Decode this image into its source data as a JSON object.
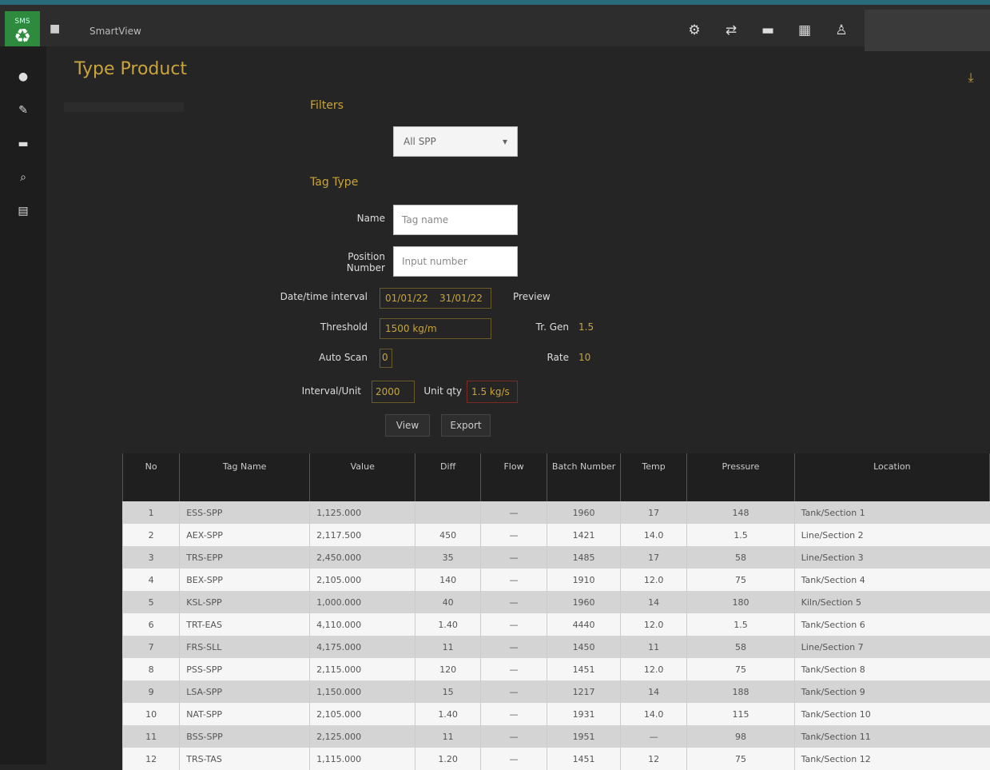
{
  "header": {
    "logo_mini": "SMS",
    "app_title": "SmartView"
  },
  "page": {
    "title": "Type Product"
  },
  "form": {
    "section1": "Filters",
    "select_value": "All SPP",
    "section2": "Tag Type",
    "field1_label": "Name",
    "field1_placeholder": "Tag name",
    "field2_label": "Position Number",
    "field2_placeholder": "Input number",
    "date_label": "Date/time interval",
    "date_from": "01/01/22",
    "date_to": "31/01/22",
    "preview_label": "Preview",
    "threshold_label": "Threshold",
    "threshold_value": "1500 kg/m",
    "tr_label": "Tr. Gen",
    "tr_value": "1.5",
    "auto_label": "Auto Scan",
    "auto_value": "0",
    "rate_label": "Rate",
    "rate_value": "10",
    "interval_label": "Interval/Unit",
    "interval_value": "2000",
    "unit_label": "Unit qty",
    "unit_value": "1.5 kg/s",
    "btn_view": "View",
    "btn_export": "Export"
  },
  "table": {
    "headers": [
      "No",
      "Tag Name",
      "Value",
      "Diff",
      "Flow",
      "Batch Number",
      "Temp",
      "Pressure",
      "Location"
    ],
    "rows": [
      [
        "1",
        "ESS-SPP",
        "1,125.000",
        "",
        "—",
        "1960",
        "17",
        "148",
        "Tank/Section 1"
      ],
      [
        "2",
        "AEX-SPP",
        "2,117.500",
        "450",
        "—",
        "1421",
        "14.0",
        "1.5",
        "Line/Section 2"
      ],
      [
        "3",
        "TRS-EPP",
        "2,450.000",
        "35",
        "—",
        "1485",
        "17",
        "58",
        "Line/Section 3"
      ],
      [
        "4",
        "BEX-SPP",
        "2,105.000",
        "140",
        "—",
        "1910",
        "12.0",
        "75",
        "Tank/Section 4"
      ],
      [
        "5",
        "KSL-SPP",
        "1,000.000",
        "40",
        "—",
        "1960",
        "14",
        "180",
        "Kiln/Section 5"
      ],
      [
        "6",
        "TRT-EAS",
        "4,110.000",
        "1.40",
        "—",
        "4440",
        "12.0",
        "1.5",
        "Tank/Section 6"
      ],
      [
        "7",
        "FRS-SLL",
        "4,175.000",
        "11",
        "—",
        "1450",
        "11",
        "58",
        "Line/Section 7"
      ],
      [
        "8",
        "PSS-SPP",
        "2,115.000",
        "120",
        "—",
        "1451",
        "12.0",
        "75",
        "Tank/Section 8"
      ],
      [
        "9",
        "LSA-SPP",
        "1,150.000",
        "15",
        "—",
        "1217",
        "14",
        "188",
        "Tank/Section 9"
      ],
      [
        "10",
        "NAT-SPP",
        "2,105.000",
        "1.40",
        "—",
        "1931",
        "14.0",
        "115",
        "Tank/Section 10"
      ],
      [
        "11",
        "BSS-SPP",
        "2,125.000",
        "11",
        "—",
        "1951",
        "—",
        "98",
        "Tank/Section 11"
      ],
      [
        "12",
        "TRS-TAS",
        "1,115.000",
        "1.20",
        "—",
        "1451",
        "12",
        "75",
        "Tank/Section 12"
      ]
    ]
  }
}
